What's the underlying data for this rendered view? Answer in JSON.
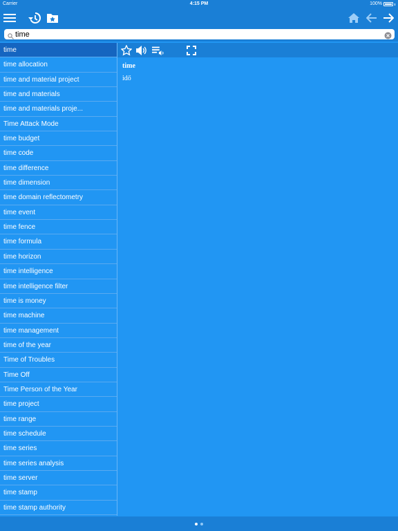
{
  "status_bar": {
    "carrier": "Carrier",
    "time": "4:15 PM",
    "battery": "100%"
  },
  "toolbar": {
    "icons": [
      "menu-icon",
      "history-icon",
      "favorites-folder-icon",
      "home-icon",
      "back-arrow-icon",
      "forward-arrow-icon"
    ]
  },
  "search": {
    "value": "time",
    "placeholder": ""
  },
  "word_list": [
    "time",
    "time allocation",
    "time and material project",
    "time and materials",
    "time and materials proje...",
    "Time Attack Mode",
    "time budget",
    "time code",
    "time difference",
    "time dimension",
    "time domain reflectometry",
    "time event",
    "time fence",
    "time formula",
    "time horizon",
    "time intelligence",
    "time intelligence filter",
    "time is money",
    "time machine",
    "time management",
    "time of the year",
    "Time of Troubles",
    "Time Off",
    "Time Person of the Year",
    "time project",
    "time range",
    "time schedule",
    "time series",
    "time series analysis",
    "time server",
    "time stamp",
    "time stamp authority"
  ],
  "selected_index": 0,
  "entry": {
    "headword": "time",
    "translation": "idő"
  },
  "action_bar": {
    "icons": [
      "star-icon",
      "speaker-icon",
      "playlist-audio-icon",
      "fullscreen-icon"
    ]
  },
  "pager": {
    "pages": 2,
    "current": 1
  },
  "colors": {
    "background": "#2196f3",
    "bar": "#1a7fd6",
    "selected_row": "#1565c0",
    "text": "#ffffff"
  }
}
